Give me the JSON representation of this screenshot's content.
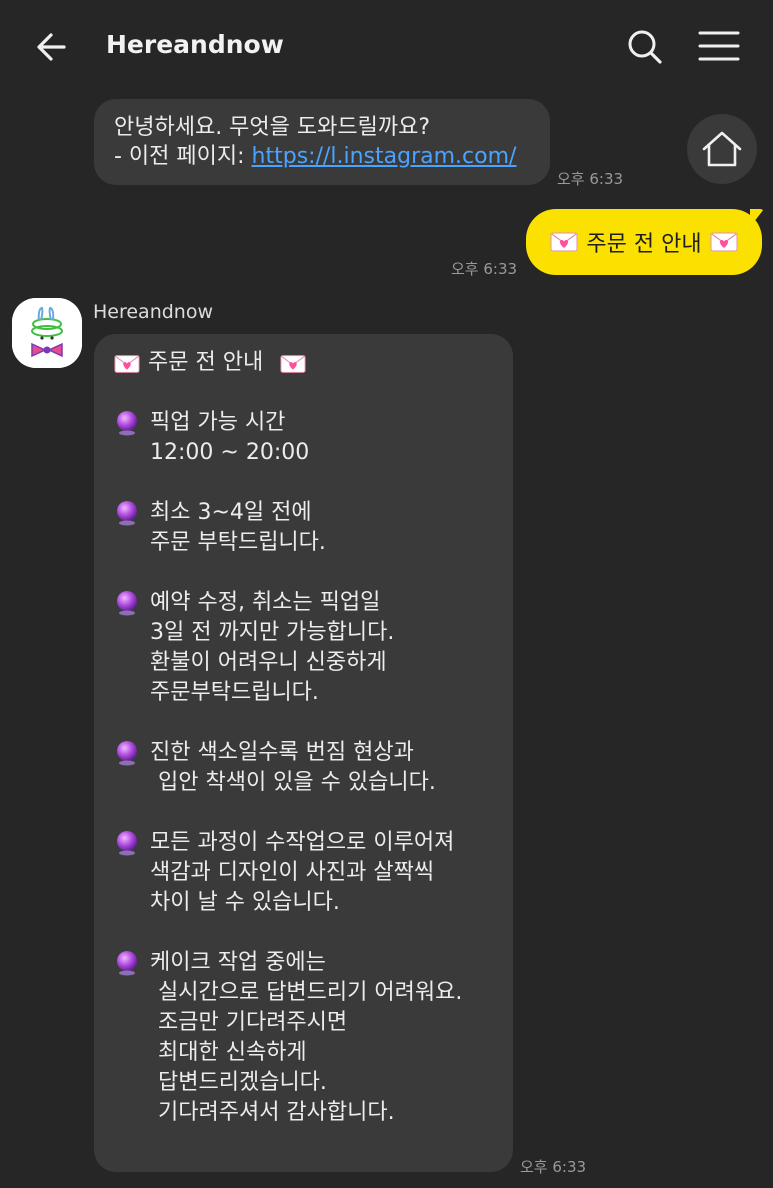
{
  "header": {
    "title": "Hereandnow",
    "back_icon": "arrow-left-icon",
    "search_icon": "search-icon",
    "menu_icon": "hamburger-menu-icon"
  },
  "home_button": {
    "icon": "home-icon"
  },
  "messages": {
    "greeting": {
      "line1": "안녕하세요. 무엇을 도와드릴까요?",
      "line2_prefix": "- 이전 페이지: ",
      "line2_link": "https://l.instagram.com/",
      "time": "오후 6:33"
    },
    "user": {
      "text": "주문 전 안내",
      "icon": "heart-envelope-icon",
      "time": "오후 6:33"
    },
    "bot": {
      "sender": "Hereandnow",
      "avatar": "bunny-cake-avatar",
      "time": "오후 6:33",
      "title": "주문 전 안내",
      "bullet_icon": "crystal-ball-icon",
      "sections": [
        {
          "lines": [
            "픽업 가능 시간",
            "12:00 ~ 20:00"
          ]
        },
        {
          "lines": [
            "최소 3~4일 전에",
            "주문 부탁드립니다."
          ]
        },
        {
          "lines": [
            "예약 수정, 취소는 픽업일",
            "3일 전 까지만 가능합니다.",
            "환불이 어려우니 신중하게",
            "주문부탁드립니다."
          ]
        },
        {
          "lines": [
            "진한 색소일수록 번짐 현상과",
            "입안 착색이 있을 수 있습니다."
          ]
        },
        {
          "lines": [
            "모든 과정이 수작업으로 이루어져",
            "색감과 디자인이 사진과 살짝씩",
            "차이 날 수 있습니다."
          ]
        },
        {
          "lines": [
            "케이크 작업 중에는",
            "실시간으로 답변드리기 어려워요.",
            "조금만 기다려주시면",
            "최대한 신속하게",
            "답변드리겠습니다.",
            "기다려주셔서 감사합니다."
          ]
        }
      ]
    }
  },
  "colors": {
    "background": "#262626",
    "bubble_in": "#3a3a3a",
    "bubble_out": "#fae100",
    "link": "#4aa3ff",
    "time": "#9a9a9a"
  }
}
